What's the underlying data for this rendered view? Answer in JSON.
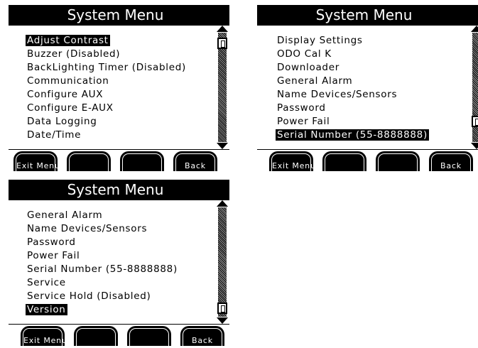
{
  "screens": [
    {
      "title": "System Menu",
      "items": [
        "Adjust Contrast",
        "Buzzer (Disabled)",
        "BackLighting Timer (Disabled)",
        "Communication",
        "Configure AUX",
        "Configure E-AUX",
        "Data Logging",
        "Date/Time"
      ],
      "selected_index": 0,
      "scroll_position": 0.05
    },
    {
      "title": "System Menu",
      "items": [
        "Display Settings",
        "ODO Cal K",
        "Downloader",
        "General Alarm",
        "Name Devices/Sensors",
        "Password",
        "Power Fail",
        "Serial Number (55-8888888)"
      ],
      "selected_index": 7,
      "scroll_position": 0.85
    },
    {
      "title": "System Menu",
      "items": [
        "General Alarm",
        "Name Devices/Sensors",
        "Password",
        "Power Fail",
        "Serial Number (55-8888888)",
        "Service",
        "Service Hold (Disabled)",
        "Version"
      ],
      "selected_index": 7,
      "scroll_position": 0.97
    }
  ],
  "softkeys": {
    "exit": "Exit Menu",
    "key2": "",
    "key3": "",
    "back": "Back"
  }
}
